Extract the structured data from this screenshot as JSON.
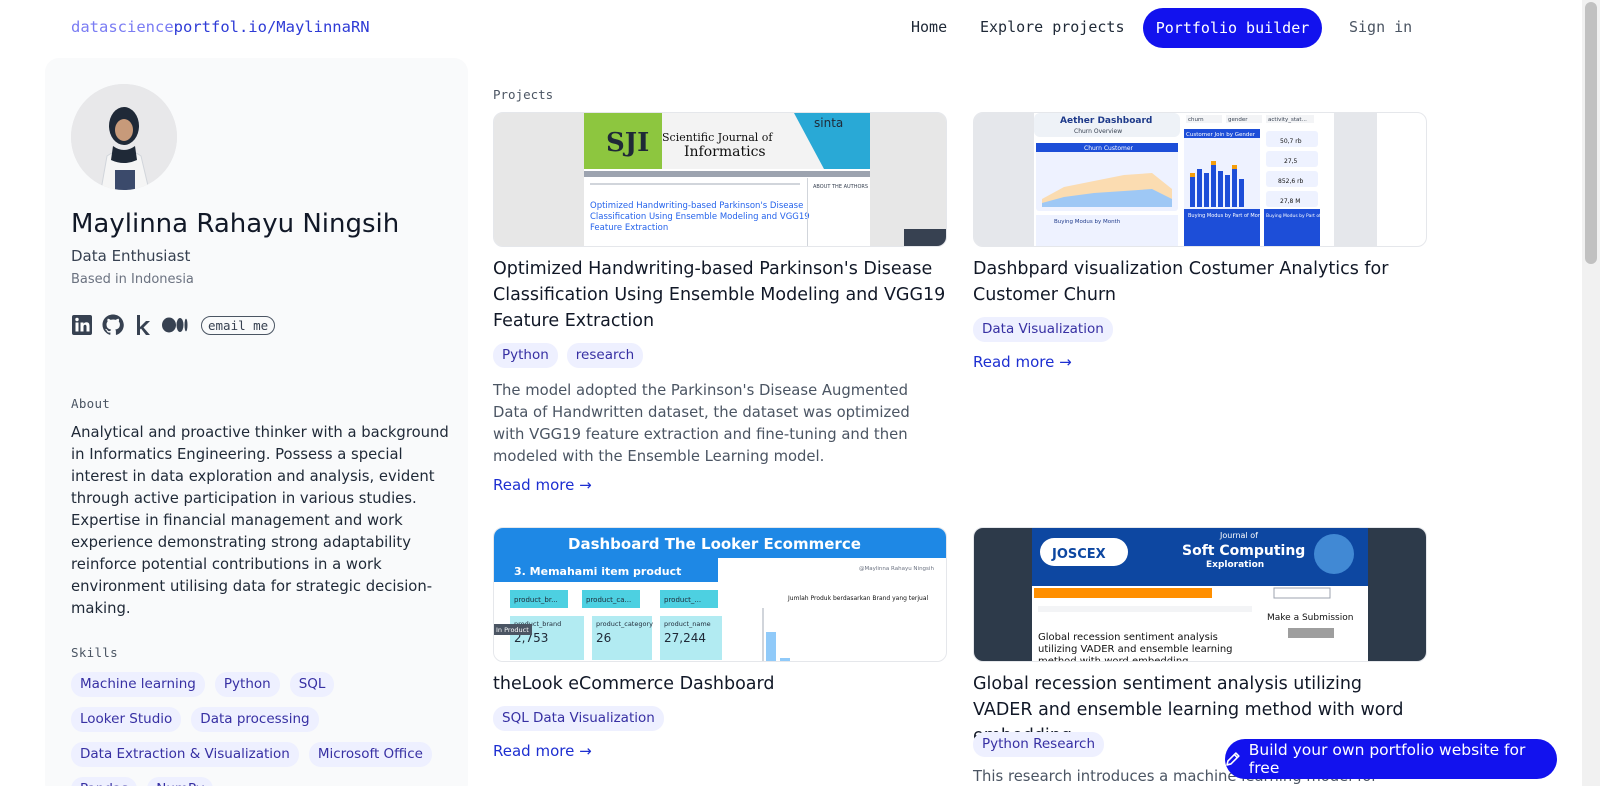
{
  "nav": {
    "brand_prefix": "datascience",
    "brand_rest": "portfol.io/MaylinnaRN",
    "home": "Home",
    "explore": "Explore projects",
    "builder": "Portfolio builder",
    "signin": "Sign in"
  },
  "profile": {
    "name": "Maylinna Rahayu Ningsih",
    "role": "Data Enthusiast",
    "location": "Based in Indonesia",
    "email_label": "email me",
    "about_label": "About",
    "about": "Analytical and proactive thinker with a background in Informatics Engineering. Possess a special interest in data exploration and analysis, evident through active participation in various studies. Expertise in financial management and work experience demonstrating strong adaptability reinforce potential contributions in a work environment utilising data for strategic decision-making.",
    "skills_label": "Skills",
    "skills": [
      "Machine learning",
      "Python",
      "SQL",
      "Looker Studio",
      "Data processing",
      "Data Extraction & Visualization",
      "Microsoft Office",
      "Pandas",
      "NumPy"
    ]
  },
  "projects_label": "Projects",
  "projects": [
    {
      "title": "Optimized Handwriting-based Parkinson's Disease Classification Using Ensemble Modeling and VGG19 Feature Extraction",
      "tags": [
        "Python",
        "research"
      ],
      "desc": "The model adopted the Parkinson's Disease Augmented Data of Handwritten dataset, the dataset was optimized with VGG19 feature extraction and fine-tuning and then modeled with the Ensemble Learning model.",
      "readmore": "Read more →",
      "thumb": {
        "journal_line1": "Scientific Journal of",
        "journal_line2": "Informatics",
        "logo": "SJI",
        "sinta": "sinta",
        "paper_title": "Optimized Handwriting-based Parkinson's Disease Classification Using Ensemble Modeling and VGG19 Feature Extraction",
        "about_authors": "ABOUT THE AUTHORS"
      }
    },
    {
      "title": "Dashbpard visualization Costumer Analytics for Customer Churn",
      "tags": [
        "Data Visualization"
      ],
      "desc": "",
      "readmore": "Read more →",
      "thumb": {
        "dash_title": "Aether Dashboard",
        "dash_sub": "Churn Overview",
        "churn_label": "Churn Customer",
        "gender_label": "Customer Join by Gender",
        "kpi": [
          "50,7 rb",
          "27,5",
          "852,6 rb",
          "27,8 M"
        ],
        "filters": [
          "churn",
          "gender",
          "activity_stat..."
        ],
        "bottom": [
          "Buying Modus by Month",
          "Buying Modus by Part of Month",
          "Buying Modus by Part of Day"
        ]
      }
    },
    {
      "title": "theLook eCommerce Dashboard",
      "tags": [
        "SQL Data Visualization"
      ],
      "desc": "",
      "readmore": "Read more →",
      "thumb": {
        "header": "Dashboard The Looker Ecommerce",
        "section": "3. Memahami item product",
        "credit": "@Maylinna Rahayu Ningsih",
        "filters": [
          "product_br...",
          "product_ca...",
          "product_..."
        ],
        "boxes": [
          {
            "label": "product_brand",
            "value": "2,753"
          },
          {
            "label": "product_category",
            "value": "26"
          },
          {
            "label": "product_name",
            "value": "27,244"
          }
        ],
        "chart_title": "Jumlah Produk berdasarkan Brand yang terjual",
        "in_product": "In Product"
      }
    },
    {
      "title": "Global recession sentiment analysis utilizing VADER and ensemble learning method with word embedding",
      "tags": [
        "Python Research"
      ],
      "desc": "This research introduces a machine learning model for Twitter",
      "readmore": "Read more →",
      "thumb": {
        "logo": "JOSCEX",
        "journal_of": "Journal of",
        "soft": "Soft Computing",
        "exploration": "Exploration",
        "paper_title": "Global recession sentiment analysis utilizing VADER and ensemble learning method with word embedding",
        "submission": "Make a Submission"
      }
    }
  ],
  "fab": "Build your own portfolio website for free"
}
